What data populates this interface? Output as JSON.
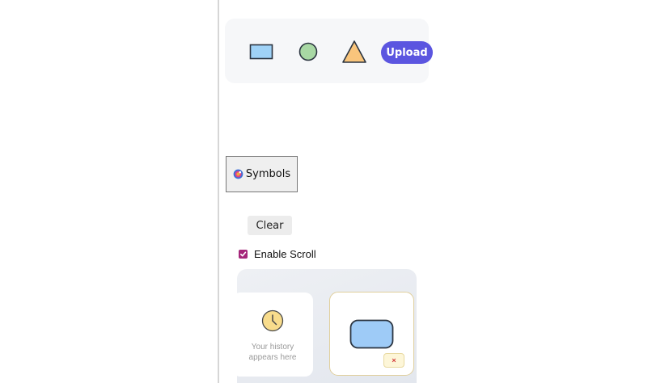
{
  "toolbar": {
    "shapes": [
      {
        "name": "rectangle",
        "fill": "#9fd2f7"
      },
      {
        "name": "circle",
        "fill": "#a8d8a4"
      },
      {
        "name": "triangle",
        "fill": "#f9c57c"
      }
    ],
    "upload_label": "Upload",
    "accent_color": "#5b55e0"
  },
  "symbols_button": {
    "label": "Symbols",
    "icon": "palette-icon"
  },
  "clear_button": {
    "label": "Clear"
  },
  "scroll_toggle": {
    "label": "Enable Scroll",
    "checked": true,
    "color": "#a5267a"
  },
  "history": {
    "empty_text": "Your history appears here",
    "icon": "clock-icon",
    "items": [
      {
        "shape": "rounded-rectangle",
        "fill": "#9ecbf7",
        "remove_label": "×"
      }
    ]
  }
}
